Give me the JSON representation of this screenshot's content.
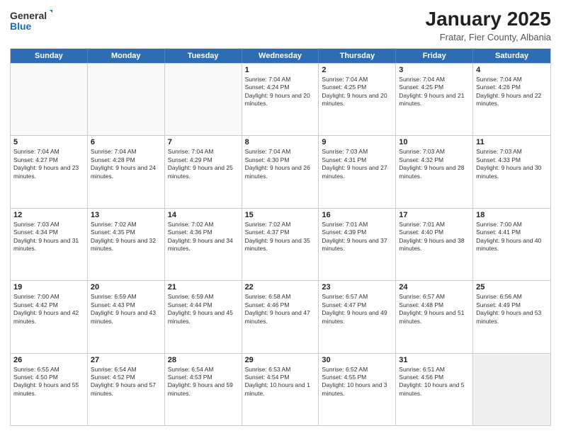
{
  "logo": {
    "general": "General",
    "blue": "Blue"
  },
  "header": {
    "title": "January 2025",
    "subtitle": "Fratar, Fier County, Albania"
  },
  "weekdays": [
    "Sunday",
    "Monday",
    "Tuesday",
    "Wednesday",
    "Thursday",
    "Friday",
    "Saturday"
  ],
  "rows": [
    [
      {
        "day": "",
        "empty": true
      },
      {
        "day": "",
        "empty": true
      },
      {
        "day": "",
        "empty": true
      },
      {
        "day": "1",
        "sunrise": "7:04 AM",
        "sunset": "4:24 PM",
        "daylight": "9 hours and 20 minutes."
      },
      {
        "day": "2",
        "sunrise": "7:04 AM",
        "sunset": "4:25 PM",
        "daylight": "9 hours and 20 minutes."
      },
      {
        "day": "3",
        "sunrise": "7:04 AM",
        "sunset": "4:25 PM",
        "daylight": "9 hours and 21 minutes."
      },
      {
        "day": "4",
        "sunrise": "7:04 AM",
        "sunset": "4:26 PM",
        "daylight": "9 hours and 22 minutes."
      }
    ],
    [
      {
        "day": "5",
        "sunrise": "7:04 AM",
        "sunset": "4:27 PM",
        "daylight": "9 hours and 23 minutes."
      },
      {
        "day": "6",
        "sunrise": "7:04 AM",
        "sunset": "4:28 PM",
        "daylight": "9 hours and 24 minutes."
      },
      {
        "day": "7",
        "sunrise": "7:04 AM",
        "sunset": "4:29 PM",
        "daylight": "9 hours and 25 minutes."
      },
      {
        "day": "8",
        "sunrise": "7:04 AM",
        "sunset": "4:30 PM",
        "daylight": "9 hours and 26 minutes."
      },
      {
        "day": "9",
        "sunrise": "7:03 AM",
        "sunset": "4:31 PM",
        "daylight": "9 hours and 27 minutes."
      },
      {
        "day": "10",
        "sunrise": "7:03 AM",
        "sunset": "4:32 PM",
        "daylight": "9 hours and 28 minutes."
      },
      {
        "day": "11",
        "sunrise": "7:03 AM",
        "sunset": "4:33 PM",
        "daylight": "9 hours and 30 minutes."
      }
    ],
    [
      {
        "day": "12",
        "sunrise": "7:03 AM",
        "sunset": "4:34 PM",
        "daylight": "9 hours and 31 minutes."
      },
      {
        "day": "13",
        "sunrise": "7:02 AM",
        "sunset": "4:35 PM",
        "daylight": "9 hours and 32 minutes."
      },
      {
        "day": "14",
        "sunrise": "7:02 AM",
        "sunset": "4:36 PM",
        "daylight": "9 hours and 34 minutes."
      },
      {
        "day": "15",
        "sunrise": "7:02 AM",
        "sunset": "4:37 PM",
        "daylight": "9 hours and 35 minutes."
      },
      {
        "day": "16",
        "sunrise": "7:01 AM",
        "sunset": "4:39 PM",
        "daylight": "9 hours and 37 minutes."
      },
      {
        "day": "17",
        "sunrise": "7:01 AM",
        "sunset": "4:40 PM",
        "daylight": "9 hours and 38 minutes."
      },
      {
        "day": "18",
        "sunrise": "7:00 AM",
        "sunset": "4:41 PM",
        "daylight": "9 hours and 40 minutes."
      }
    ],
    [
      {
        "day": "19",
        "sunrise": "7:00 AM",
        "sunset": "4:42 PM",
        "daylight": "9 hours and 42 minutes."
      },
      {
        "day": "20",
        "sunrise": "6:59 AM",
        "sunset": "4:43 PM",
        "daylight": "9 hours and 43 minutes."
      },
      {
        "day": "21",
        "sunrise": "6:59 AM",
        "sunset": "4:44 PM",
        "daylight": "9 hours and 45 minutes."
      },
      {
        "day": "22",
        "sunrise": "6:58 AM",
        "sunset": "4:46 PM",
        "daylight": "9 hours and 47 minutes."
      },
      {
        "day": "23",
        "sunrise": "6:57 AM",
        "sunset": "4:47 PM",
        "daylight": "9 hours and 49 minutes."
      },
      {
        "day": "24",
        "sunrise": "6:57 AM",
        "sunset": "4:48 PM",
        "daylight": "9 hours and 51 minutes."
      },
      {
        "day": "25",
        "sunrise": "6:56 AM",
        "sunset": "4:49 PM",
        "daylight": "9 hours and 53 minutes."
      }
    ],
    [
      {
        "day": "26",
        "sunrise": "6:55 AM",
        "sunset": "4:50 PM",
        "daylight": "9 hours and 55 minutes."
      },
      {
        "day": "27",
        "sunrise": "6:54 AM",
        "sunset": "4:52 PM",
        "daylight": "9 hours and 57 minutes."
      },
      {
        "day": "28",
        "sunrise": "6:54 AM",
        "sunset": "4:53 PM",
        "daylight": "9 hours and 59 minutes."
      },
      {
        "day": "29",
        "sunrise": "6:53 AM",
        "sunset": "4:54 PM",
        "daylight": "10 hours and 1 minute."
      },
      {
        "day": "30",
        "sunrise": "6:52 AM",
        "sunset": "4:55 PM",
        "daylight": "10 hours and 3 minutes."
      },
      {
        "day": "31",
        "sunrise": "6:51 AM",
        "sunset": "4:56 PM",
        "daylight": "10 hours and 5 minutes."
      },
      {
        "day": "",
        "empty": true,
        "shaded": true
      }
    ]
  ]
}
